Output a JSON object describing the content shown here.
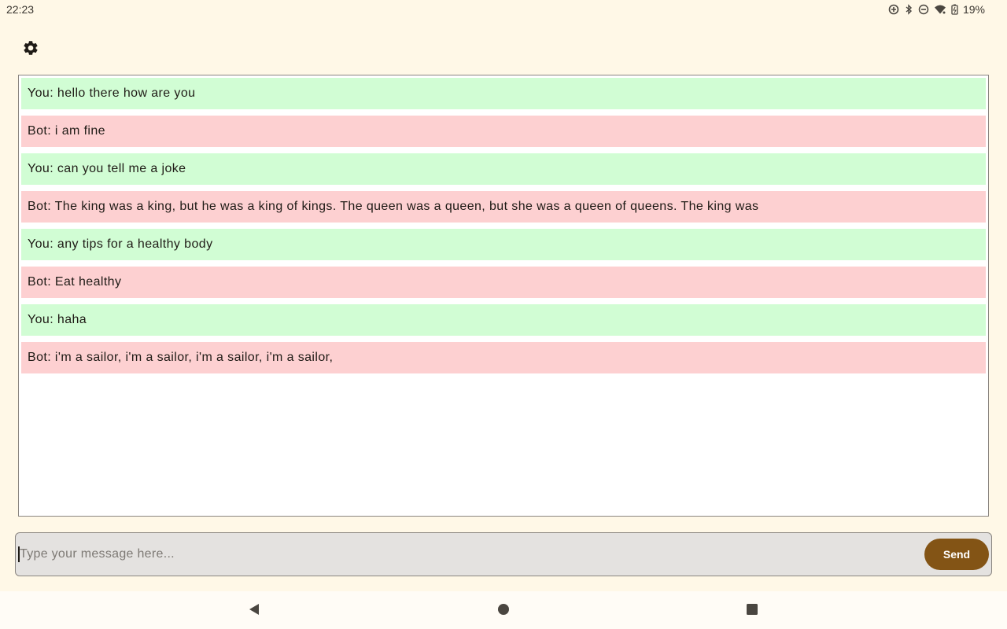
{
  "status_bar": {
    "time": "22:23",
    "battery_percent": "19%",
    "icons": [
      "data-saver-icon",
      "bluetooth-icon",
      "do-not-disturb-icon",
      "wifi-icon",
      "battery-charging-icon"
    ]
  },
  "toolbar": {
    "settings_icon": "gear-icon"
  },
  "chat": {
    "messages": [
      {
        "sender": "user",
        "text": "You: hello there how are you"
      },
      {
        "sender": "bot",
        "text": "Bot: i am fine"
      },
      {
        "sender": "user",
        "text": "You: can you tell me a joke"
      },
      {
        "sender": "bot",
        "text": "Bot: The king was a king, but he was a king of kings. The queen was a queen, but she was a queen of queens. The king was"
      },
      {
        "sender": "user",
        "text": "You: any tips for a healthy body"
      },
      {
        "sender": "bot",
        "text": "Bot: Eat healthy"
      },
      {
        "sender": "user",
        "text": "You: haha"
      },
      {
        "sender": "bot",
        "text": "Bot: i'm a sailor, i'm a sailor, i'm a sailor, i'm a sailor,"
      }
    ]
  },
  "composer": {
    "value": "",
    "placeholder": "Type your message here...",
    "send_label": "Send"
  },
  "colors": {
    "background": "#fff8e7",
    "user_bubble": "#d1fdd4",
    "bot_bubble": "#fdd0d1",
    "send_button": "#835415"
  },
  "nav_bar": {
    "back_icon": "back-triangle-icon",
    "home_icon": "home-circle-icon",
    "recents_icon": "recents-square-icon"
  }
}
